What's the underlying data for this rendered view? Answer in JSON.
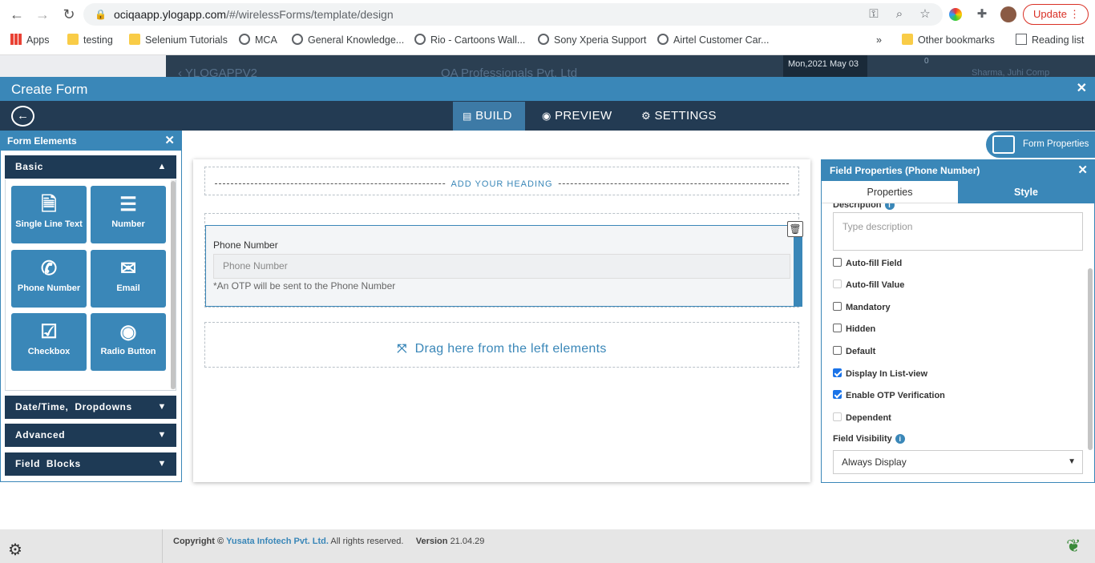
{
  "browser": {
    "url_host": "ociqaapp.ylogapp.com",
    "url_path": "/#/wirelessForms/template/design",
    "update_label": "Update",
    "bookmarks": [
      {
        "label": "Apps",
        "icon": "apps-grid-icon"
      },
      {
        "label": "testing",
        "icon": "folder-icon"
      },
      {
        "label": "Selenium Tutorials",
        "icon": "folder-icon"
      },
      {
        "label": "MCA",
        "icon": "globe-icon"
      },
      {
        "label": "General Knowledge...",
        "icon": "globe-icon"
      },
      {
        "label": "Rio - Cartoons Wall...",
        "icon": "globe-icon"
      },
      {
        "label": "Sony Xperia Support",
        "icon": "globe-icon"
      },
      {
        "label": "Airtel Customer Car...",
        "icon": "globe-icon"
      },
      {
        "label": "Other bookmarks",
        "icon": "folder-icon"
      },
      {
        "label": "Reading list",
        "icon": "reading-list-icon"
      }
    ],
    "overflow_label": "»"
  },
  "app_header": {
    "app_name": "YLOGAPPV2",
    "company": "QA Professionals Pvt. Ltd",
    "date": "Mon,2021 May 03",
    "user": "Sharma, Juhi Comp",
    "notif_count": "0"
  },
  "modal": {
    "title": "Create Form",
    "tabs": [
      {
        "label": "BUILD",
        "icon": "build-icon"
      },
      {
        "label": "PREVIEW",
        "icon": "eye-icon"
      },
      {
        "label": "SETTINGS",
        "icon": "gear-icon"
      }
    ],
    "active_tab": "BUILD"
  },
  "form_elements": {
    "title": "Form Elements",
    "sections": [
      {
        "label": "Basic",
        "expanded": true
      },
      {
        "label": "Date/Time,  Dropdowns",
        "expanded": false
      },
      {
        "label": "Advanced",
        "expanded": false
      },
      {
        "label": "Field  Blocks",
        "expanded": false
      }
    ],
    "tiles": [
      {
        "label": "Single Line Text",
        "icon": "document-icon"
      },
      {
        "label": "Number",
        "icon": "numbered-list-icon"
      },
      {
        "label": "Phone Number",
        "icon": "phone-icon"
      },
      {
        "label": "Email",
        "icon": "envelope-icon"
      },
      {
        "label": "Checkbox",
        "icon": "checkbox-icon"
      },
      {
        "label": "Radio Button",
        "icon": "radio-icon"
      }
    ]
  },
  "canvas": {
    "heading_placeholder": "ADD YOUR HEADING",
    "field": {
      "label": "Phone Number",
      "placeholder": "Phone Number",
      "note": "*An OTP will be sent to the Phone Number"
    },
    "drop_hint": "Drag here from the left elements"
  },
  "form_properties_label": "Form Properties",
  "field_properties": {
    "title": "Field Properties (Phone Number)",
    "tabs": [
      "Properties",
      "Style"
    ],
    "description_label": "Description",
    "description_placeholder": "Type description",
    "options": [
      {
        "label": "Auto-fill Field",
        "checked": false,
        "disabled": false
      },
      {
        "label": "Auto-fill Value",
        "checked": false,
        "disabled": true
      },
      {
        "label": "Mandatory",
        "checked": false,
        "disabled": false
      },
      {
        "label": "Hidden",
        "checked": false,
        "disabled": false
      },
      {
        "label": "Default",
        "checked": false,
        "disabled": false
      },
      {
        "label": "Display In List-view",
        "checked": true,
        "disabled": false
      },
      {
        "label": "Enable OTP Verification",
        "checked": true,
        "disabled": false
      },
      {
        "label": "Dependent",
        "checked": false,
        "disabled": true
      }
    ],
    "visibility_label": "Field Visibility",
    "visibility_value": "Always Display"
  },
  "footer": {
    "copyright_prefix": "Copyright ©",
    "company": "Yusata Infotech Pvt. Ltd.",
    "rights": "All rights reserved.",
    "version_label": "Version",
    "version": "21.04.29"
  },
  "colors": {
    "accent": "#3a87b8",
    "navy": "#1e3a55",
    "tabbar": "#233b53"
  }
}
